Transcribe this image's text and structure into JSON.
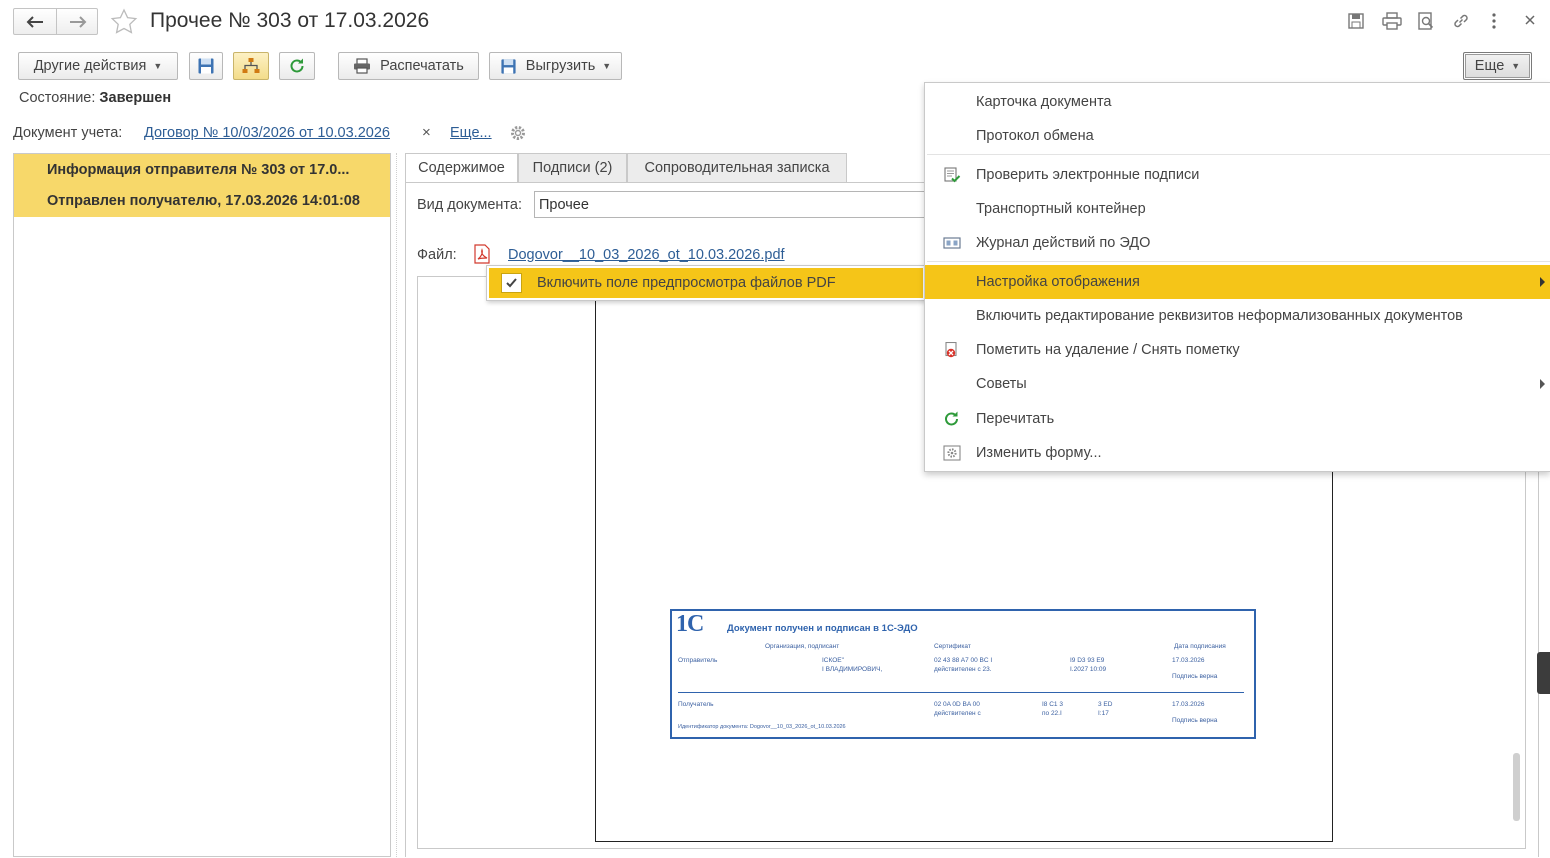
{
  "window": {
    "title": "Прочее № 303 от 17.03.2026",
    "favorite_icon": "star-icon"
  },
  "toolbar": {
    "other_actions_label": "Другие действия",
    "print_label": "Распечатать",
    "export_label": "Выгрузить",
    "more_label": "Еще"
  },
  "status": {
    "label": "Состояние:",
    "value": "Завершен"
  },
  "document_ref": {
    "label": "Документ учета:",
    "link": "Договор № 10/03/2026 от 10.03.2026",
    "clear": "×",
    "more_link": "Еще..."
  },
  "left_panel": {
    "items": [
      {
        "text": "Информация отправителя № 303 от 17.0..."
      },
      {
        "text": "Отправлен получателю, 17.03.2026 14:01:08"
      }
    ]
  },
  "tabs": [
    {
      "label": "Содержимое"
    },
    {
      "label": "Подписи (2)"
    },
    {
      "label": "Сопроводительная записка"
    }
  ],
  "form": {
    "doc_type_label": "Вид документа:",
    "doc_type_value": "Прочее",
    "file_label": "Файл:",
    "file_link": "Dogovor__10_03_2026_ot_10.03.2026.pdf"
  },
  "submenu": {
    "item_label": "Включить поле предпросмотра файлов PDF",
    "checked": true
  },
  "menu": {
    "items": [
      {
        "label": "Карточка документа"
      },
      {
        "label": "Протокол обмена"
      },
      {
        "label": "Проверить электронные подписи"
      },
      {
        "label": "Транспортный контейнер"
      },
      {
        "label": "Журнал действий по ЭДО"
      },
      {
        "label": "Настройка отображения"
      },
      {
        "label": "Включить редактирование реквизитов неформализованных документов"
      },
      {
        "label": "Пометить на удаление / Снять пометку"
      },
      {
        "label": "Советы"
      },
      {
        "label": "Перечитать"
      },
      {
        "label": "Изменить форму..."
      }
    ]
  },
  "stamp": {
    "logo": "1С",
    "title": "Документ получен и подписан в 1С-ЭДО",
    "col_org": "Организация, подписант",
    "col_cert": "Сертификат",
    "col_date": "Дата подписания",
    "sender_label": "Отправитель",
    "sender_org": "ІСКОЕ\"",
    "sender_person": "І ВЛАДИМИРОВИЧ,",
    "sender_cert": "02 43 88 A7 00 BC І",
    "sender_valid": "действителен с 23.",
    "sender_cert2": "І9 D3 93 E9",
    "sender_valid2": "І.2027 10:09",
    "sender_date": "17.03.2026",
    "sender_status": "Подпись верна",
    "receiver_label": "Получатель",
    "receiver_cert": "02 0A 0D BA 00",
    "receiver_valid": "действителен с",
    "receiver_cert2": "І8 C1 3",
    "receiver_valid2": "по 22.І",
    "receiver_cert3": "3 ED",
    "receiver_valid3": "І:17",
    "receiver_date": "17.03.2026",
    "receiver_status": "Подпись верна",
    "doc_id": "Идентификатор документа: Dogovor__10_03_2026_ot_10.03.2026"
  },
  "colors": {
    "highlight": "#f7d86a",
    "menu_highlight": "#f5c518",
    "link": "#2d5d95",
    "stamp_blue": "#2f63ad"
  }
}
